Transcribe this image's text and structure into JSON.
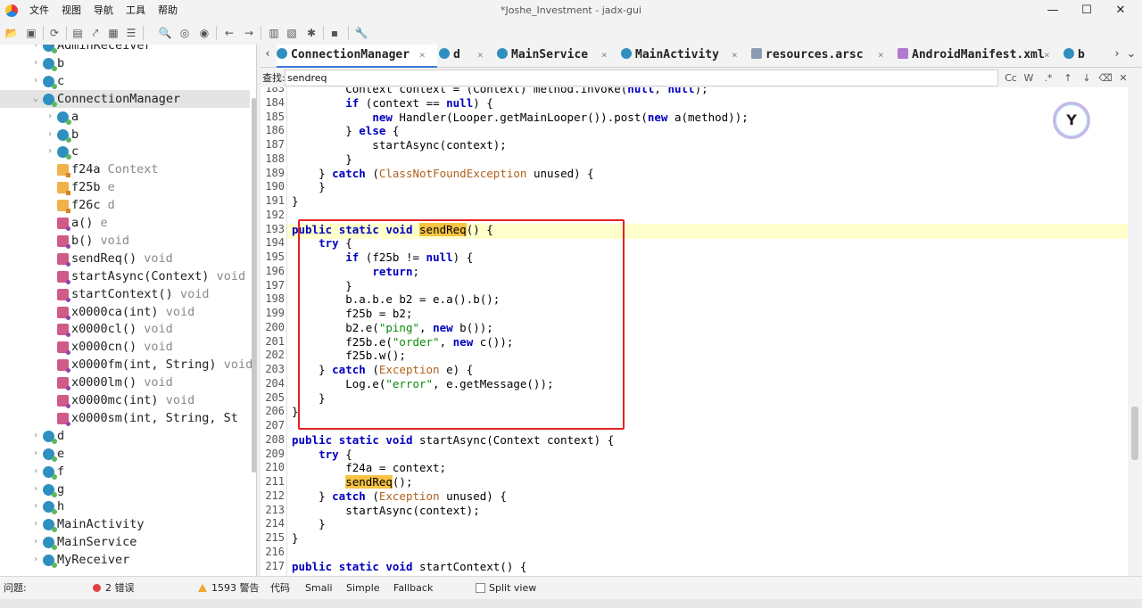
{
  "window": {
    "title": "*Joshe_Investment - jadx-gui",
    "menu": [
      "文件",
      "视图",
      "导航",
      "工具",
      "帮助"
    ],
    "controls": {
      "minimize": "—",
      "maximize": "☐",
      "close": "✕"
    }
  },
  "toolbar": {
    "icons": [
      "open-project-icon",
      "add-files-icon",
      "sync-icon",
      "save-icon",
      "export-icon",
      "export-gradle-icon",
      "search-icon",
      "find-usage-icon",
      "go-to-icon",
      "back-icon",
      "forward-icon",
      "flatten-icon",
      "decompile-icon",
      "debug-icon",
      "log-icon",
      "settings-icon"
    ]
  },
  "tree": {
    "items": [
      {
        "label": "AdminReceiver",
        "type": "",
        "icon": "class",
        "indent": 1,
        "arrow": "›"
      },
      {
        "label": "b",
        "type": "",
        "icon": "class",
        "indent": 1,
        "arrow": "›"
      },
      {
        "label": "c",
        "type": "",
        "icon": "class",
        "indent": 1,
        "arrow": "›"
      },
      {
        "label": "ConnectionManager",
        "type": "",
        "icon": "class",
        "indent": 1,
        "arrow": "⌄",
        "selected": true
      },
      {
        "label": "a",
        "type": "",
        "icon": "class",
        "indent": 2,
        "arrow": "›"
      },
      {
        "label": "b",
        "type": "",
        "icon": "class",
        "indent": 2,
        "arrow": "›"
      },
      {
        "label": "c",
        "type": "",
        "icon": "class",
        "indent": 2,
        "arrow": "›"
      },
      {
        "label": "f24a",
        "type": "Context",
        "icon": "field",
        "indent": 2,
        "arrow": ""
      },
      {
        "label": "f25b",
        "type": "e",
        "icon": "field",
        "indent": 2,
        "arrow": ""
      },
      {
        "label": "f26c",
        "type": "d",
        "icon": "field",
        "indent": 2,
        "arrow": ""
      },
      {
        "label": "a()",
        "type": "e",
        "icon": "method",
        "indent": 2,
        "arrow": ""
      },
      {
        "label": "b()",
        "type": "void",
        "icon": "method",
        "indent": 2,
        "arrow": ""
      },
      {
        "label": "sendReq()",
        "type": "void",
        "icon": "method",
        "indent": 2,
        "arrow": ""
      },
      {
        "label": "startAsync(Context)",
        "type": "void",
        "icon": "method",
        "indent": 2,
        "arrow": ""
      },
      {
        "label": "startContext()",
        "type": "void",
        "icon": "method",
        "indent": 2,
        "arrow": ""
      },
      {
        "label": "x0000ca(int)",
        "type": "void",
        "icon": "method",
        "indent": 2,
        "arrow": ""
      },
      {
        "label": "x0000cl()",
        "type": "void",
        "icon": "method",
        "indent": 2,
        "arrow": ""
      },
      {
        "label": "x0000cn()",
        "type": "void",
        "icon": "method",
        "indent": 2,
        "arrow": ""
      },
      {
        "label": "x0000fm(int, String)",
        "type": "void",
        "icon": "method",
        "indent": 2,
        "arrow": ""
      },
      {
        "label": "x0000lm()",
        "type": "void",
        "icon": "method",
        "indent": 2,
        "arrow": ""
      },
      {
        "label": "x0000mc(int)",
        "type": "void",
        "icon": "method",
        "indent": 2,
        "arrow": ""
      },
      {
        "label": "x0000sm(int, String, St",
        "type": "",
        "icon": "method",
        "indent": 2,
        "arrow": ""
      },
      {
        "label": "d",
        "type": "",
        "icon": "class",
        "indent": 1,
        "arrow": "›"
      },
      {
        "label": "e",
        "type": "",
        "icon": "class",
        "indent": 1,
        "arrow": "›"
      },
      {
        "label": "f",
        "type": "",
        "icon": "class",
        "indent": 1,
        "arrow": "›"
      },
      {
        "label": "g",
        "type": "",
        "icon": "class",
        "indent": 1,
        "arrow": "›"
      },
      {
        "label": "h",
        "type": "",
        "icon": "class",
        "indent": 1,
        "arrow": "›"
      },
      {
        "label": "MainActivity",
        "type": "",
        "icon": "class",
        "indent": 1,
        "arrow": "›"
      },
      {
        "label": "MainService",
        "type": "",
        "icon": "class",
        "indent": 1,
        "arrow": "›"
      },
      {
        "label": "MyReceiver",
        "type": "",
        "icon": "class",
        "indent": 1,
        "arrow": "›"
      }
    ]
  },
  "tabs": {
    "nav_left": "‹",
    "nav_right": "›",
    "menu": "⌄",
    "items": [
      {
        "label": "ConnectionManager",
        "icon": "class",
        "active": true
      },
      {
        "label": "d",
        "icon": "class",
        "active": false
      },
      {
        "label": "MainService",
        "icon": "class",
        "active": false
      },
      {
        "label": "MainActivity",
        "icon": "class",
        "active": false
      },
      {
        "label": "resources.arsc",
        "icon": "res",
        "active": false
      },
      {
        "label": "AndroidManifest.xml",
        "icon": "xml",
        "active": false
      },
      {
        "label": "b",
        "icon": "class",
        "active": false
      }
    ]
  },
  "search": {
    "label": "查找:",
    "value": "sendreq",
    "buttons": [
      "Cc",
      "W",
      ".*",
      "↑",
      "↓",
      "⌫",
      "✕"
    ]
  },
  "code": {
    "current_line": 193,
    "lines": [
      {
        "n": 183,
        "tokens": [
          [
            "        Context context = (Context) method.invoke(",
            ""
          ],
          [
            "null",
            "kw"
          ],
          [
            ", ",
            ""
          ],
          [
            "null",
            "kw"
          ],
          [
            ");",
            ""
          ]
        ]
      },
      {
        "n": 184,
        "tokens": [
          [
            "        ",
            ""
          ],
          [
            "if",
            "kw"
          ],
          [
            " (context == ",
            ""
          ],
          [
            "null",
            "kw"
          ],
          [
            ") {",
            ""
          ]
        ]
      },
      {
        "n": 185,
        "tokens": [
          [
            "            ",
            ""
          ],
          [
            "new",
            "kw"
          ],
          [
            " Handler(Looper.getMainLooper()).post(",
            ""
          ],
          [
            "new",
            "kw"
          ],
          [
            " a(method));",
            ""
          ]
        ]
      },
      {
        "n": 186,
        "tokens": [
          [
            "        } ",
            ""
          ],
          [
            "else",
            "kw"
          ],
          [
            " {",
            ""
          ]
        ]
      },
      {
        "n": 187,
        "tokens": [
          [
            "            startAsync(context);",
            ""
          ]
        ]
      },
      {
        "n": 188,
        "tokens": [
          [
            "        }",
            ""
          ]
        ]
      },
      {
        "n": 189,
        "tokens": [
          [
            "    } ",
            ""
          ],
          [
            "catch",
            "kw"
          ],
          [
            " (",
            ""
          ],
          [
            "ClassNotFoundException",
            "cls"
          ],
          [
            " unused) {",
            ""
          ]
        ]
      },
      {
        "n": 190,
        "tokens": [
          [
            "    }",
            ""
          ]
        ]
      },
      {
        "n": 191,
        "tokens": [
          [
            "}",
            ""
          ]
        ]
      },
      {
        "n": 192,
        "tokens": [
          [
            "",
            ""
          ]
        ]
      },
      {
        "n": 193,
        "tokens": [
          [
            "",
            ""
          ],
          [
            "public",
            "kw"
          ],
          [
            " ",
            ""
          ],
          [
            "static",
            "kw"
          ],
          [
            " ",
            ""
          ],
          [
            "void",
            "kw"
          ],
          [
            " ",
            ""
          ],
          [
            "sendReq",
            "hl"
          ],
          [
            "() {",
            ""
          ]
        ]
      },
      {
        "n": 194,
        "tokens": [
          [
            "    ",
            ""
          ],
          [
            "try",
            "kw"
          ],
          [
            " {",
            ""
          ]
        ]
      },
      {
        "n": 195,
        "tokens": [
          [
            "        ",
            ""
          ],
          [
            "if",
            "kw"
          ],
          [
            " (f25b != ",
            ""
          ],
          [
            "null",
            "kw"
          ],
          [
            ") {",
            ""
          ]
        ]
      },
      {
        "n": 196,
        "tokens": [
          [
            "            ",
            ""
          ],
          [
            "return",
            "kw"
          ],
          [
            ";",
            ""
          ]
        ]
      },
      {
        "n": 197,
        "tokens": [
          [
            "        }",
            ""
          ]
        ]
      },
      {
        "n": 198,
        "tokens": [
          [
            "        b.a.b.e b2 = e.a().b();",
            ""
          ]
        ]
      },
      {
        "n": 199,
        "tokens": [
          [
            "        f25b = b2;",
            ""
          ]
        ]
      },
      {
        "n": 200,
        "tokens": [
          [
            "        b2.e(",
            ""
          ],
          [
            "\"ping\"",
            "str"
          ],
          [
            ", ",
            ""
          ],
          [
            "new",
            "kw"
          ],
          [
            " b());",
            ""
          ]
        ]
      },
      {
        "n": 201,
        "tokens": [
          [
            "        f25b.e(",
            ""
          ],
          [
            "\"order\"",
            "str"
          ],
          [
            ", ",
            ""
          ],
          [
            "new",
            "kw"
          ],
          [
            " c());",
            ""
          ]
        ]
      },
      {
        "n": 202,
        "tokens": [
          [
            "        f25b.w();",
            ""
          ]
        ]
      },
      {
        "n": 203,
        "tokens": [
          [
            "    } ",
            ""
          ],
          [
            "catch",
            "kw"
          ],
          [
            " (",
            ""
          ],
          [
            "Exception",
            "cls"
          ],
          [
            " e) {",
            ""
          ]
        ]
      },
      {
        "n": 204,
        "tokens": [
          [
            "        Log.e(",
            ""
          ],
          [
            "\"error\"",
            "str"
          ],
          [
            ", e.getMessage());",
            ""
          ]
        ]
      },
      {
        "n": 205,
        "tokens": [
          [
            "    }",
            ""
          ]
        ]
      },
      {
        "n": 206,
        "tokens": [
          [
            "}",
            ""
          ]
        ]
      },
      {
        "n": 207,
        "tokens": [
          [
            "",
            ""
          ]
        ]
      },
      {
        "n": 208,
        "tokens": [
          [
            "",
            ""
          ],
          [
            "public",
            "kw"
          ],
          [
            " ",
            ""
          ],
          [
            "static",
            "kw"
          ],
          [
            " ",
            ""
          ],
          [
            "void",
            "kw"
          ],
          [
            " startAsync(Context context) {",
            ""
          ]
        ]
      },
      {
        "n": 209,
        "tokens": [
          [
            "    ",
            ""
          ],
          [
            "try",
            "kw"
          ],
          [
            " {",
            ""
          ]
        ]
      },
      {
        "n": 210,
        "tokens": [
          [
            "        f24a = context;",
            ""
          ]
        ]
      },
      {
        "n": 211,
        "tokens": [
          [
            "        ",
            ""
          ],
          [
            "sendReq",
            "hl"
          ],
          [
            "();",
            ""
          ]
        ]
      },
      {
        "n": 212,
        "tokens": [
          [
            "    } ",
            ""
          ],
          [
            "catch",
            "kw"
          ],
          [
            " (",
            ""
          ],
          [
            "Exception",
            "cls"
          ],
          [
            " unused) {",
            ""
          ]
        ]
      },
      {
        "n": 213,
        "tokens": [
          [
            "        startAsync(context);",
            ""
          ]
        ]
      },
      {
        "n": 214,
        "tokens": [
          [
            "    }",
            ""
          ]
        ]
      },
      {
        "n": 215,
        "tokens": [
          [
            "}",
            ""
          ]
        ]
      },
      {
        "n": 216,
        "tokens": [
          [
            "",
            ""
          ]
        ]
      },
      {
        "n": 217,
        "tokens": [
          [
            "",
            ""
          ],
          [
            "public",
            "kw"
          ],
          [
            " ",
            ""
          ],
          [
            "static",
            "kw"
          ],
          [
            " ",
            ""
          ],
          [
            "void",
            "kw"
          ],
          [
            " startContext() {",
            ""
          ]
        ]
      }
    ]
  },
  "bottom": {
    "problems_label": "问题:",
    "errors": "2 错误",
    "warnings": "1593 警告",
    "view_tabs": [
      "代码",
      "Smali",
      "Simple",
      "Fallback"
    ],
    "split_view": "Split view"
  },
  "colors": {
    "accent": "#3d7bd8",
    "highlight": "#f6c342",
    "keyword": "#0000c0",
    "string": "#0a8a0a",
    "annotation_box": "#e32222"
  }
}
